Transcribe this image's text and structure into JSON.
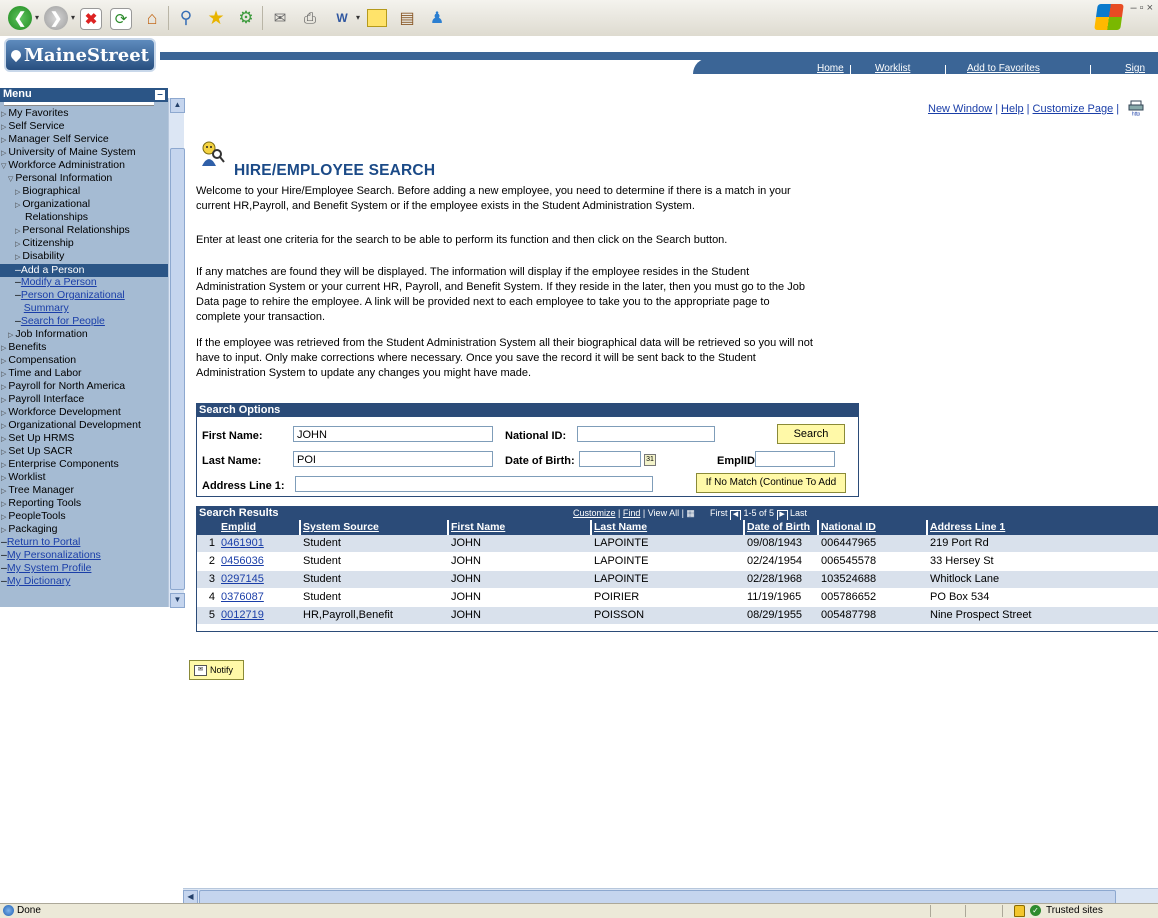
{
  "header": {
    "logo_text": "MaineStreet",
    "nav": [
      "Home",
      "Worklist",
      "Add to Favorites",
      "Sign out"
    ]
  },
  "sidebar": {
    "title": "Menu",
    "items": [
      {
        "label": "My Favorites",
        "kind": "folder"
      },
      {
        "label": "Self Service",
        "kind": "folder"
      },
      {
        "label": "Manager Self Service",
        "kind": "folder"
      },
      {
        "label": "University of Maine System",
        "kind": "folder"
      },
      {
        "label": "Workforce Administration",
        "kind": "open"
      },
      {
        "label": "Personal Information",
        "kind": "open"
      },
      {
        "label": "Biographical",
        "kind": "folder"
      },
      {
        "label": "Organizational",
        "kind": "folder"
      },
      {
        "label": "Relationships",
        "kind": "cont"
      },
      {
        "label": "Personal Relationships",
        "kind": "folder"
      },
      {
        "label": "Citizenship",
        "kind": "folder"
      },
      {
        "label": "Disability",
        "kind": "folder"
      },
      {
        "label": "Add a Person",
        "kind": "selected"
      },
      {
        "label": "Modify a Person",
        "kind": "link"
      },
      {
        "label": "Person Organizational",
        "kind": "link"
      },
      {
        "label": "Summary",
        "kind": "linkcont"
      },
      {
        "label": "Search for People",
        "kind": "link"
      },
      {
        "label": "Job Information",
        "kind": "folder"
      },
      {
        "label": "Benefits",
        "kind": "folder"
      },
      {
        "label": "Compensation",
        "kind": "folder"
      },
      {
        "label": "Time and Labor",
        "kind": "folder"
      },
      {
        "label": "Payroll for North America",
        "kind": "folder"
      },
      {
        "label": "Payroll Interface",
        "kind": "folder"
      },
      {
        "label": "Workforce Development",
        "kind": "folder"
      },
      {
        "label": "Organizational Development",
        "kind": "folder"
      },
      {
        "label": "Set Up HRMS",
        "kind": "folder"
      },
      {
        "label": "Set Up SACR",
        "kind": "folder"
      },
      {
        "label": "Enterprise Components",
        "kind": "folder"
      },
      {
        "label": "Worklist",
        "kind": "folder"
      },
      {
        "label": "Tree Manager",
        "kind": "folder"
      },
      {
        "label": "Reporting Tools",
        "kind": "folder"
      },
      {
        "label": "PeopleTools",
        "kind": "folder"
      },
      {
        "label": "Packaging",
        "kind": "folder"
      },
      {
        "label": "Return to Portal",
        "kind": "toplink"
      },
      {
        "label": "My Personalizations",
        "kind": "toplink"
      },
      {
        "label": "My System Profile",
        "kind": "toplink"
      },
      {
        "label": "My Dictionary",
        "kind": "toplink"
      }
    ]
  },
  "top_links": {
    "new_window": "New Window",
    "help": "Help",
    "customize": "Customize Page",
    "print_icon_text": "http"
  },
  "page": {
    "title": "HIRE/EMPLOYEE SEARCH",
    "para1": "Welcome to your Hire/Employee Search. Before adding a new employee, you need to determine if there is a match in your current HR,Payroll, and Benefit System or if the employee exists in the Student Administration System.",
    "para2": "Enter at least one criteria for the search to be able to perform its function and then click on the Search button.",
    "para3": "If any matches are found they will be displayed. The information will display if the employee resides in the Student Administration System or your current HR, Payroll, and Benefit System. If they reside in the later, then you must go to the Job Data page to rehire the employee. A link will be provided next to each employee to take you to the appropriate page to complete your transaction.",
    "para4": "If the employee was retrieved from the Student Administration System all their biographical data will be retrieved so you will not have to input. Only make corrections where necessary. Once you save the record it will be sent back to the Student Administration System to update any changes you might have made."
  },
  "search_options": {
    "title": "Search Options",
    "first_name_label": "First Name:",
    "first_name_value": "JOHN",
    "last_name_label": "Last Name:",
    "last_name_value": "POI",
    "address_label": "Address Line 1:",
    "address_value": "",
    "national_id_label": "National ID:",
    "national_id_value": "",
    "dob_label": "Date of Birth:",
    "dob_value": "",
    "emplid_label": "EmplID",
    "emplid_value": "",
    "search_button": "Search",
    "no_match_button": "If No Match (Continue To Add"
  },
  "results": {
    "title": "Search Results",
    "customize": "Customize",
    "find": "Find",
    "view_all": "View All",
    "first": "First",
    "range": "1-5 of 5",
    "last": "Last",
    "columns": [
      "Emplid",
      "System Source",
      "First Name",
      "Last Name",
      "Date of Birth",
      "National ID",
      "Address Line 1"
    ],
    "rows": [
      {
        "n": "1",
        "emplid": "0461901",
        "source": "Student",
        "first": "JOHN",
        "last": "LAPOINTE",
        "dob": "09/08/1943",
        "nid": "006447965",
        "addr": "219 Port Rd"
      },
      {
        "n": "2",
        "emplid": "0456036",
        "source": "Student",
        "first": "JOHN",
        "last": "LAPOINTE",
        "dob": "02/24/1954",
        "nid": "006545578",
        "addr": "33 Hersey St"
      },
      {
        "n": "3",
        "emplid": "0297145",
        "source": "Student",
        "first": "JOHN",
        "last": "LAPOINTE",
        "dob": "02/28/1968",
        "nid": "103524688",
        "addr": "Whitlock Lane"
      },
      {
        "n": "4",
        "emplid": "0376087",
        "source": "Student",
        "first": "JOHN",
        "last": "POIRIER",
        "dob": "11/19/1965",
        "nid": "005786652",
        "addr": "PO Box 534"
      },
      {
        "n": "5",
        "emplid": "0012719",
        "source": "HR,Payroll,Benefit",
        "first": "JOHN",
        "last": "POISSON",
        "dob": "08/29/1955",
        "nid": "005487798",
        "addr": "Nine Prospect Street"
      }
    ]
  },
  "notify_button": "Notify",
  "statusbar": {
    "status": "Done",
    "zone": "Trusted sites"
  },
  "colors": {
    "nav_blue": "#3b6596",
    "menu_bg": "#a5bbd3",
    "title_blue": "#1b4a87",
    "button_yellow": "#fff9a8"
  }
}
